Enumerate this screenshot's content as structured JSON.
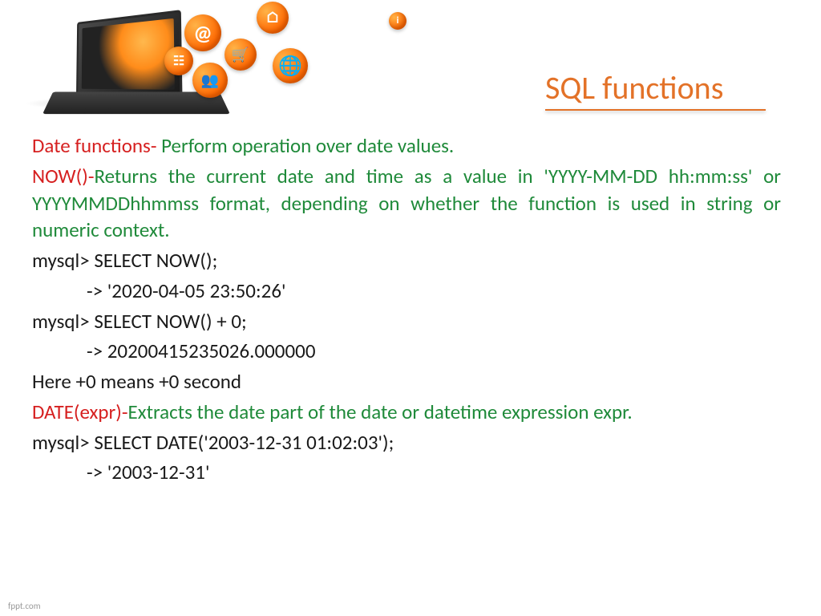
{
  "title": " SQL functions",
  "section1": {
    "label": "Date functions-",
    "desc": " Perform operation over date values."
  },
  "now": {
    "label": "NOW()-",
    "desc": "Returns the current date and time as a value in 'YYYY-MM-DD hh:mm:ss' or YYYYMMDDhhmmss format, depending on whether the function is used in string or numeric context."
  },
  "ex1_line1": "mysql> SELECT NOW();",
  "ex1_line2": "-> '2020-04-05 23:50:26'",
  "ex2_line1": "mysql> SELECT NOW() + 0;",
  "ex2_line2": "-> 20200415235026.000000",
  "note": "Here +0 means +0 second",
  "date_expr": {
    "label": "DATE(expr)-",
    "desc": "Extracts the date part of the date or datetime expression expr."
  },
  "ex3_line1": "mysql> SELECT DATE('2003-12-31 01:02:03');",
  "ex3_line2": "-> '2003-12-31'",
  "footer": "fppt.com",
  "icons": {
    "home": "⌂",
    "at": "@",
    "cart": "🛒",
    "people": "👥",
    "globe": "🌐",
    "net": "☷",
    "info": "i"
  }
}
